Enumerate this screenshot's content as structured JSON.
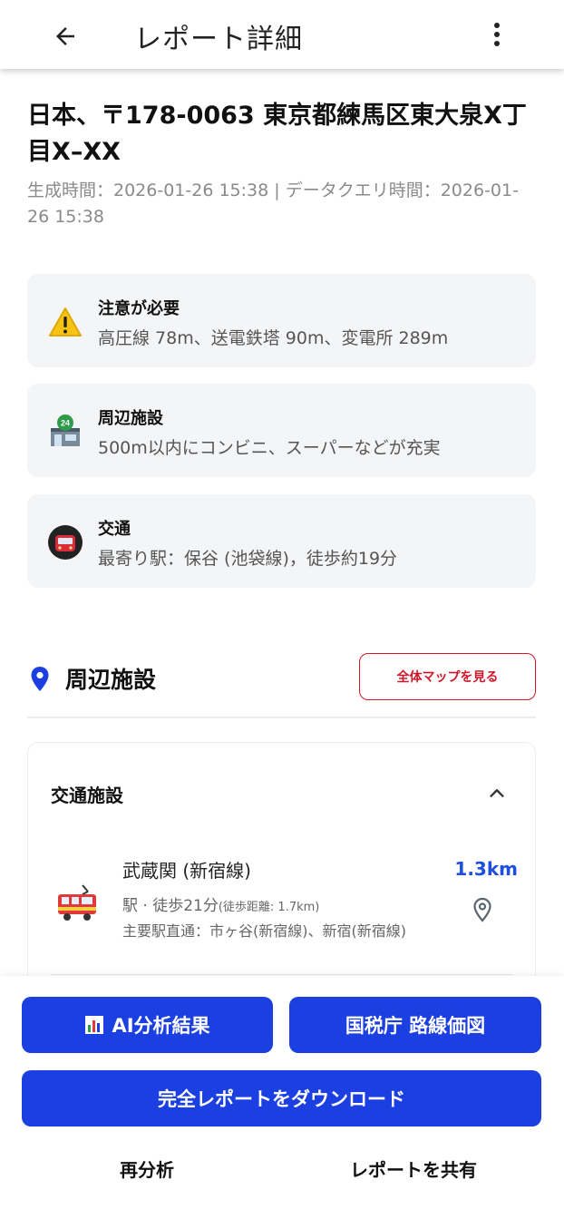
{
  "appbar": {
    "title": "レポート詳細",
    "back_icon": "arrow-left-icon",
    "more_icon": "more-vertical-icon"
  },
  "address": "日本、〒178-0063 東京都練馬区東大泉X丁目X–XX",
  "meta": "生成時間：2026-01-26 15:38 | データクエリ時間：2026-01-26 15:38",
  "cards": [
    {
      "title": "注意が必要",
      "body": "高圧線 78m、送電鉄塔 90m、変電所 289m",
      "icon": "warning-icon"
    },
    {
      "title": "周辺施設",
      "body": "500m以内にコンビニ、スーパーなどが充実",
      "icon": "convenience-store-icon"
    },
    {
      "title": "交通",
      "body": "最寄り駅：保谷 (池袋線)，徒歩約19分",
      "icon": "train-icon"
    }
  ],
  "nearby": {
    "title": "周辺施設",
    "map_button": "全体マップを見る",
    "accent": "#d0182a"
  },
  "transport_panel": {
    "title": "交通施設",
    "station": {
      "name": "武蔵関 (新宿線)",
      "distance": "1.3km",
      "detail": "駅 · 徒歩21分",
      "walk_distance": "(徒歩距離: 1.7km)",
      "routes": "主要駅直通：市ヶ谷(新宿線)、新宿(新宿線)"
    }
  },
  "actions": {
    "ai_label": "AI分析結果",
    "tax_label": "国税庁 路線価図",
    "download_label": "完全レポートをダウンロード",
    "reanalyze_label": "再分析",
    "share_label": "レポートを共有",
    "primary_color": "#1b3fe0"
  }
}
